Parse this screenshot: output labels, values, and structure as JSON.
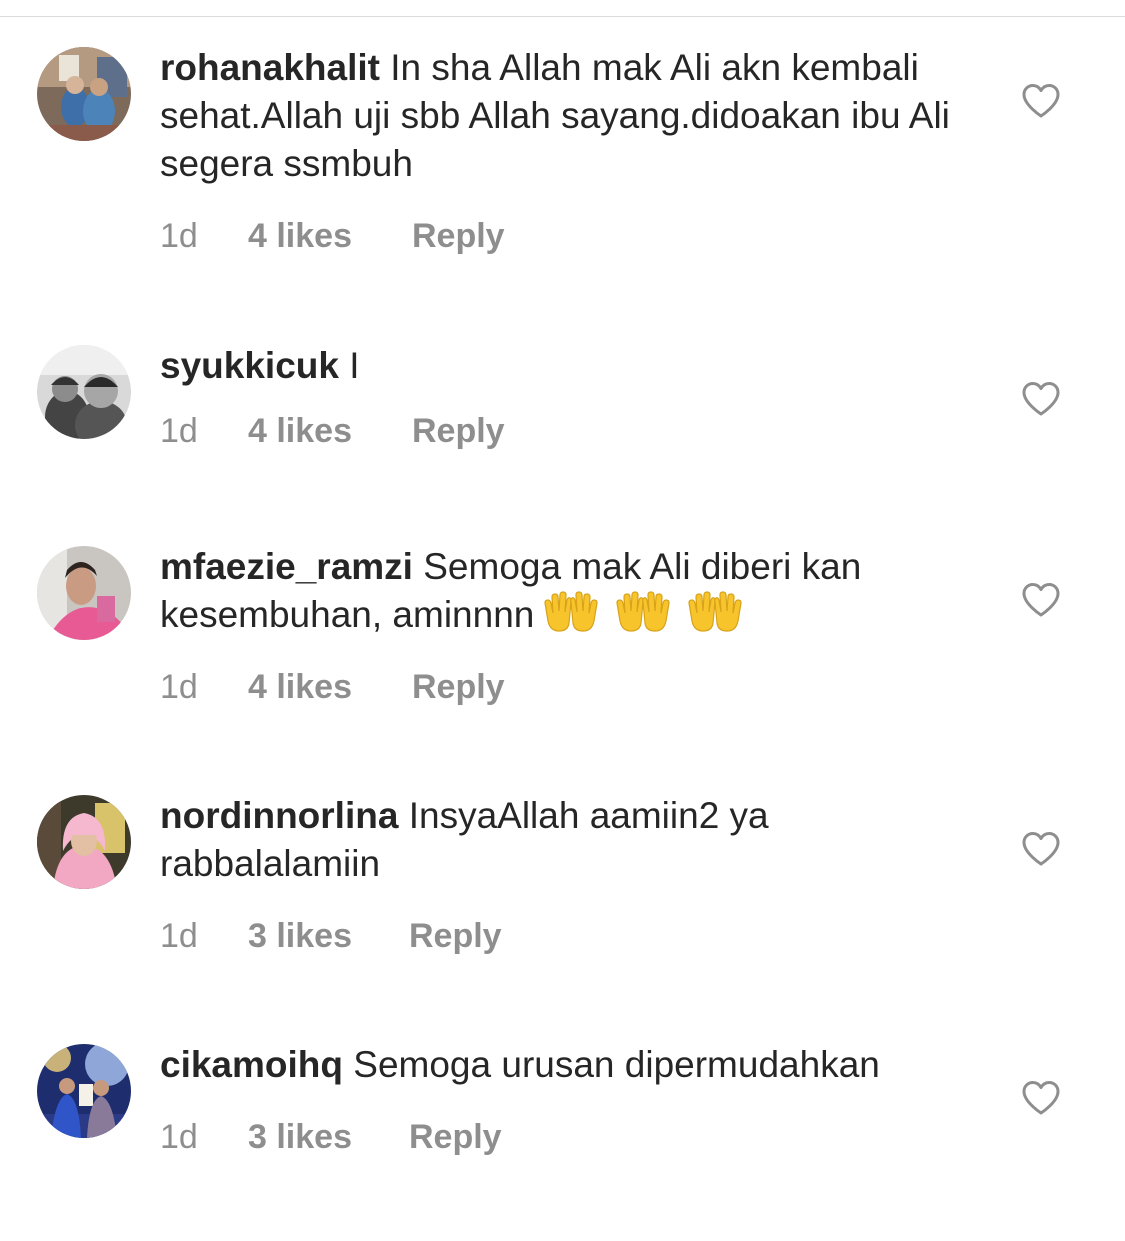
{
  "comments": [
    {
      "username": "rohanakhalit",
      "text": "In sha Allah mak Ali akn kembali sehat.Allah uji sbb Allah sayang.didoakan ibu Ali segera ssmbuh",
      "time": "1d",
      "likes": "4 likes",
      "reply": "Reply"
    },
    {
      "username": "syukkicuk",
      "text": "I",
      "time": "1d",
      "likes": "4 likes",
      "reply": "Reply"
    },
    {
      "username": "mfaezie_ramzi",
      "text": "Semoga mak Ali diberi kan kesembuhan, aminnnn",
      "emoji": "open-hands-emoji x3",
      "time": "1d",
      "likes": "4 likes",
      "reply": "Reply"
    },
    {
      "username": "nordinnorlina",
      "text": "InsyaAllah aamiin2 ya rabbalalamiin",
      "time": "1d",
      "likes": "3 likes",
      "reply": "Reply"
    },
    {
      "username": "cikamoihq",
      "text": "Semoga urusan dipermudahkan",
      "time": "1d",
      "likes": "3 likes",
      "reply": "Reply"
    }
  ],
  "icons": {
    "like": "heart-outline-icon",
    "emoji": "open-hands-emoji"
  },
  "colors": {
    "text": "#262626",
    "secondary": "#8e8e8e",
    "divider": "#dbdbdb",
    "emoji": "#f7c52b"
  }
}
